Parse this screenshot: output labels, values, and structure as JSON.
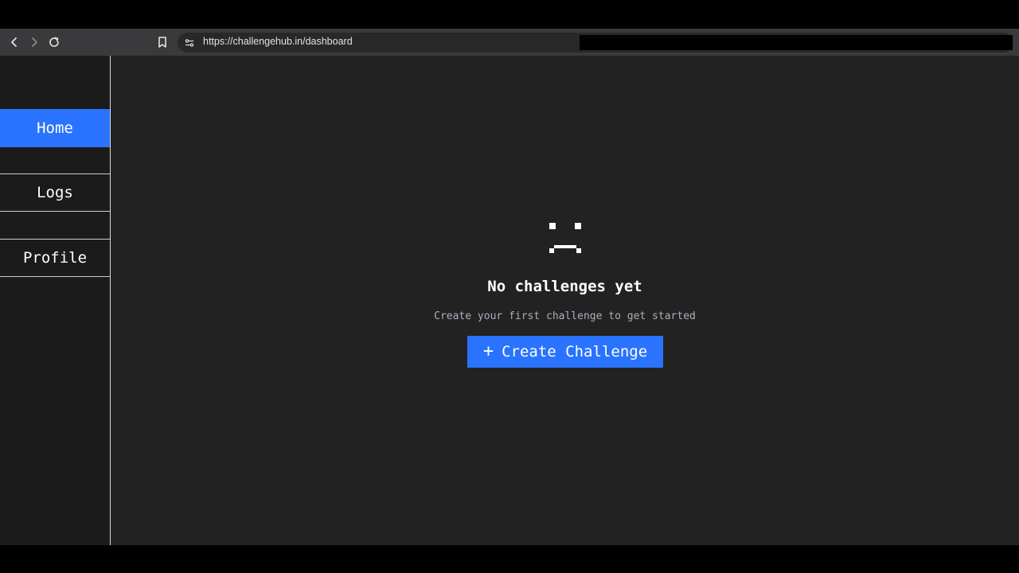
{
  "browser": {
    "url": "https://challengehub.in/dashboard",
    "icons": [
      "back-icon",
      "forward-icon",
      "reload-icon",
      "bookmark-icon",
      "site-info-icon"
    ]
  },
  "sidebar": {
    "items": [
      {
        "label": "Home",
        "active": true
      },
      {
        "label": "Logs",
        "active": false
      },
      {
        "label": "Profile",
        "active": false
      }
    ]
  },
  "empty_state": {
    "icon": "sad-face-icon",
    "title": "No challenges yet",
    "subtitle": "Create your first challenge to get started",
    "cta_icon": "+",
    "cta_label": "Create Challenge"
  },
  "colors": {
    "accent": "#2a73ff",
    "background": "#222222",
    "sidebar": "#1b1b1b",
    "subtitle": "#a8b0bd"
  }
}
